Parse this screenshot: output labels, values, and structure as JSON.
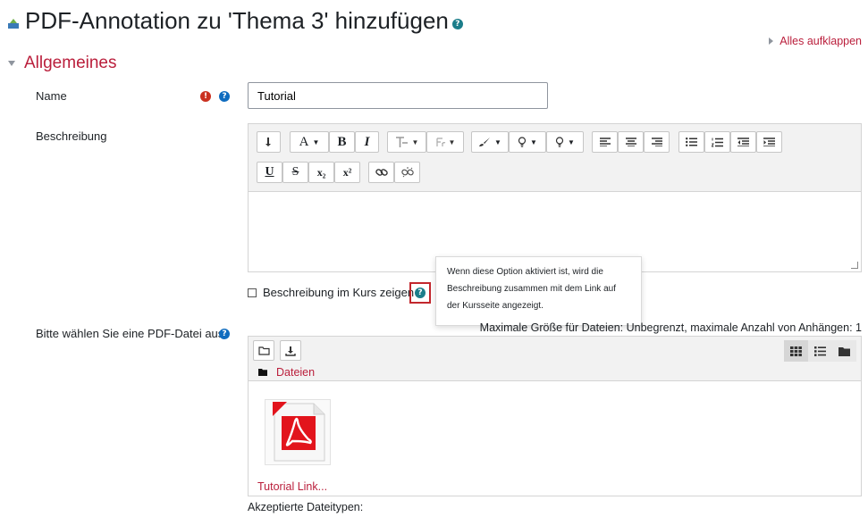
{
  "page": {
    "title": "PDF-Annotation zu 'Thema 3' hinzufügen",
    "expand_all": "Alles aufklappen"
  },
  "section": {
    "title": "Allgemeines"
  },
  "name_field": {
    "label": "Name",
    "value": "Tutorial"
  },
  "description": {
    "label": "Beschreibung",
    "toolbar": {
      "font_size": "A",
      "bold": "B",
      "italic": "I",
      "underline": "U",
      "strike": "S",
      "subscript": "x₂",
      "superscript": "x²"
    },
    "show_in_course_label": "Beschreibung im Kurs zeigen",
    "tooltip": "Wenn diese Option aktiviert ist, wird die Beschreibung zusammen mit dem Link auf der Kursseite angezeigt."
  },
  "file": {
    "label": "Bitte wählen Sie eine PDF-Datei aus.",
    "max_size": "Maximale Größe für Dateien: Unbegrenzt, maximale Anzahl von Anhängen: 1",
    "path": "Dateien",
    "file_name": "Tutorial Link...",
    "accepted_types_label": "Akzeptierte Dateitypen:"
  },
  "colors": {
    "accent": "#ba1e3b",
    "help": "#0f6cbf",
    "required": "#ca3120",
    "pdf": "#e2141c"
  }
}
